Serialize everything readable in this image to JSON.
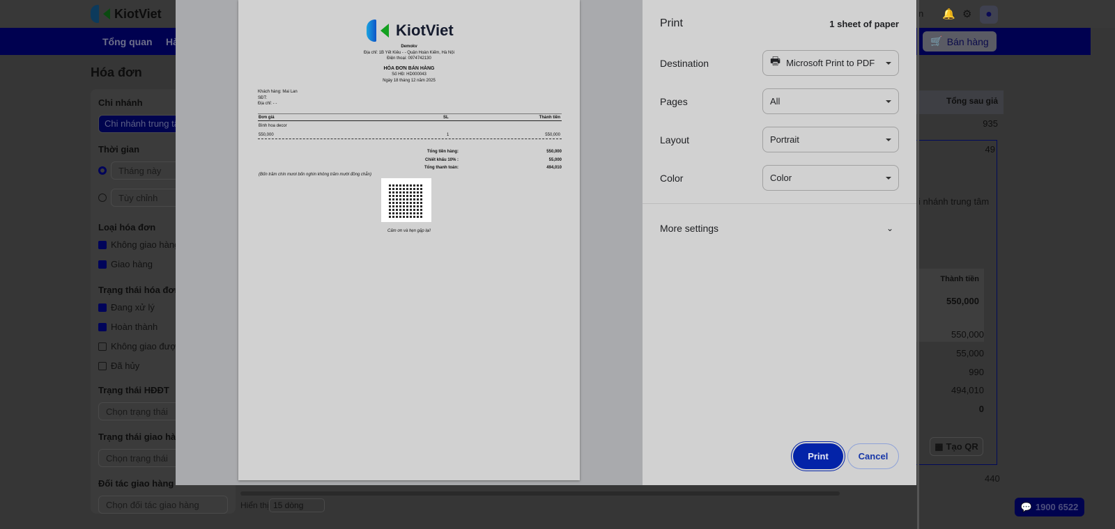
{
  "app": {
    "brand": "KiotViet",
    "user_fragment": "n",
    "nav": [
      "Tổng quan",
      "Hà"
    ],
    "sell_button": "Bán hàng",
    "page_title": "Hóa đơn"
  },
  "filters": {
    "branch_label": "Chi nhánh",
    "branch_value": "Chi nhánh trung tâ",
    "time_label": "Thời gian",
    "time_options": [
      "Tháng này",
      "Tùy chỉnh"
    ],
    "type_label": "Loại hóa đơn",
    "types": [
      {
        "label": "Không giao hàng",
        "checked": true
      },
      {
        "label": "Giao hàng",
        "checked": true
      }
    ],
    "status_label": "Trạng thái hóa đơn",
    "statuses": [
      {
        "label": "Đang xử lý",
        "checked": true
      },
      {
        "label": "Hoàn thành",
        "checked": true
      },
      {
        "label": "Không giao được",
        "checked": false
      },
      {
        "label": "Đã hủy",
        "checked": false
      }
    ],
    "einvoice_label": "Trạng thái HĐĐT",
    "einvoice_placeholder": "Chọn trạng thái",
    "delivery_label": "Trạng thái giao hàng",
    "delivery_placeholder": "Chọn trạng thái",
    "partner_label": "Đối tác giao hàng",
    "partner_placeholder": "Chọn đối tác giao hàng"
  },
  "pager": {
    "label": "Hiển thị",
    "value": "15 dòng"
  },
  "right": {
    "col_header": "Tổng sau giả",
    "row1": "935",
    "row2": "49",
    "branch": "i nhánh trung tâm",
    "item_header": "Thành tiền",
    "item_total": "550,000",
    "sums": [
      "550,000",
      "55,000",
      "990",
      "494,010",
      "0"
    ],
    "qr_button": "Tạo QR",
    "footer_val": "440",
    "hotline": "1900 6522"
  },
  "receipt": {
    "store": "Demokv",
    "address": "Địa chỉ: 1B Yết Kiêu - - Quận Hoàn Kiếm, Hà Nội",
    "phone": "Điện thoại: 0974742130",
    "title": "HÓA ĐƠN BÁN HÀNG",
    "number": "Số HĐ: HD000043",
    "date": "Ngày 18 tháng 12 năm 2025",
    "customer": "Khách hàng: Mai Lan",
    "sdt": "SĐT:",
    "cust_address": "Địa chỉ: - -",
    "headers": [
      "Đơn giá",
      "SL",
      "Thành tiền"
    ],
    "item_name": "Bình hoa decor",
    "item_price": "550,000",
    "item_qty": "1",
    "item_amount": "550,000",
    "totals": [
      {
        "label": "Tổng tiền hàng:",
        "value": "550,000"
      },
      {
        "label": "Chiết khấu 10% :",
        "value": "55,000"
      },
      {
        "label": "Tổng thanh toán:",
        "value": "494,010"
      }
    ],
    "in_words": "(Bốn trăm chín mươi bốn nghìn không trăm mười đồng chẵn)",
    "thanks": "Cảm ơn và hẹn gặp lại!"
  },
  "print": {
    "title": "Print",
    "sheets": "1 sheet of paper",
    "destination_label": "Destination",
    "destination": "Microsoft Print to PDF",
    "pages_label": "Pages",
    "pages": "All",
    "layout_label": "Layout",
    "layout": "Portrait",
    "color_label": "Color",
    "color": "Color",
    "more": "More settings",
    "print_button": "Print",
    "cancel_button": "Cancel"
  }
}
